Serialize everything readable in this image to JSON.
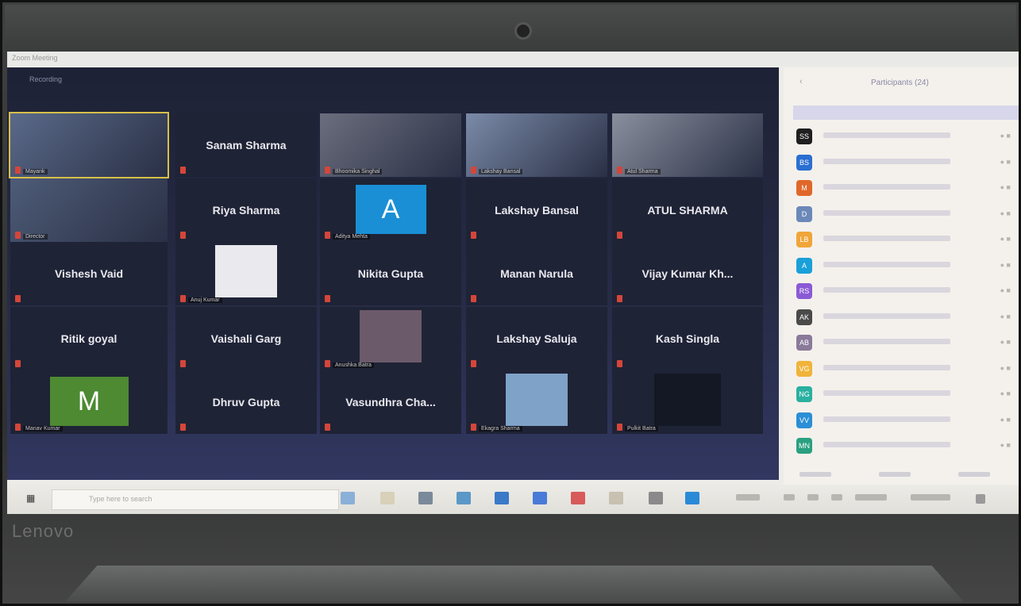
{
  "window": {
    "title": "Zoom Meeting"
  },
  "meeting": {
    "label": "Recording"
  },
  "panel": {
    "title": "Participants (24)"
  },
  "taskbar": {
    "search_placeholder": "Type here to search"
  },
  "laptop": {
    "brand": "Lenovo"
  },
  "tiles": [
    {
      "name": "",
      "caption": "Mayank",
      "type": "video",
      "color": "#5a6a8a",
      "active": true
    },
    {
      "name": "Sanam Sharma",
      "caption": "",
      "type": "name"
    },
    {
      "name": "",
      "caption": "Bhoomika Singhal",
      "type": "video",
      "color": "#6b6e7e"
    },
    {
      "name": "",
      "caption": "Lakshay Bansal",
      "type": "video",
      "color": "#7a8aa8"
    },
    {
      "name": "",
      "caption": "Atul Sharma",
      "type": "video",
      "color": "#8a8f9e"
    },
    {
      "name": "",
      "caption": "Director",
      "type": "video",
      "color": "#4e5c78"
    },
    {
      "name": "Riya Sharma",
      "caption": "",
      "type": "name"
    },
    {
      "name": "",
      "caption": "Aditya Mehta",
      "type": "avatar",
      "letter": "A",
      "color": "#1a8fd6"
    },
    {
      "name": "Lakshay Bansal",
      "caption": "",
      "type": "name"
    },
    {
      "name": "ATUL SHARMA",
      "caption": "",
      "type": "name"
    },
    {
      "name": "Vishesh Vaid",
      "caption": "",
      "type": "name"
    },
    {
      "name": "",
      "caption": "Anuj Kumar",
      "type": "photo",
      "color": "#e9e9ee"
    },
    {
      "name": "Nikita Gupta",
      "caption": "",
      "type": "name"
    },
    {
      "name": "Manan Narula",
      "caption": "",
      "type": "name"
    },
    {
      "name": "Vijay Kumar Kh...",
      "caption": "",
      "type": "name"
    },
    {
      "name": "Ritik goyal",
      "caption": "",
      "type": "name"
    },
    {
      "name": "Vaishali Garg",
      "caption": "",
      "type": "name"
    },
    {
      "name": "",
      "caption": "Anushka Batra",
      "type": "photo",
      "color": "#6b5a6a"
    },
    {
      "name": "Lakshay Saluja",
      "caption": "",
      "type": "name"
    },
    {
      "name": "Kash Singla",
      "caption": "",
      "type": "name"
    },
    {
      "name": "",
      "caption": "Manav Kumar",
      "type": "avatar",
      "letter": "M",
      "color": "#4d8a32"
    },
    {
      "name": "Dhruv Gupta",
      "caption": "",
      "type": "name"
    },
    {
      "name": "Vasundhra Cha...",
      "caption": "",
      "type": "name"
    },
    {
      "name": "",
      "caption": "Ekagra Sharma",
      "type": "photo",
      "color": "#7fa2c8"
    },
    {
      "name": "",
      "caption": "Pulkit Batra",
      "type": "dark",
      "color": "#141824"
    }
  ],
  "participants": [
    {
      "initials": "SS",
      "color": "#1f1f1f"
    },
    {
      "initials": "BS",
      "color": "#2a6fd1"
    },
    {
      "initials": "M",
      "color": "#e0672a"
    },
    {
      "initials": "D",
      "color": "#6b88b8"
    },
    {
      "initials": "LB",
      "color": "#f0a53a"
    },
    {
      "initials": "A",
      "color": "#1aa0d8"
    },
    {
      "initials": "RS",
      "color": "#8a5ad6"
    },
    {
      "initials": "AK",
      "color": "#4a4a4a"
    },
    {
      "initials": "AB",
      "color": "#8a7a9a"
    },
    {
      "initials": "VG",
      "color": "#f0b43a"
    },
    {
      "initials": "NG",
      "color": "#2ab0a0"
    },
    {
      "initials": "VV",
      "color": "#2a8fd6"
    },
    {
      "initials": "MN",
      "color": "#2aa080"
    }
  ]
}
